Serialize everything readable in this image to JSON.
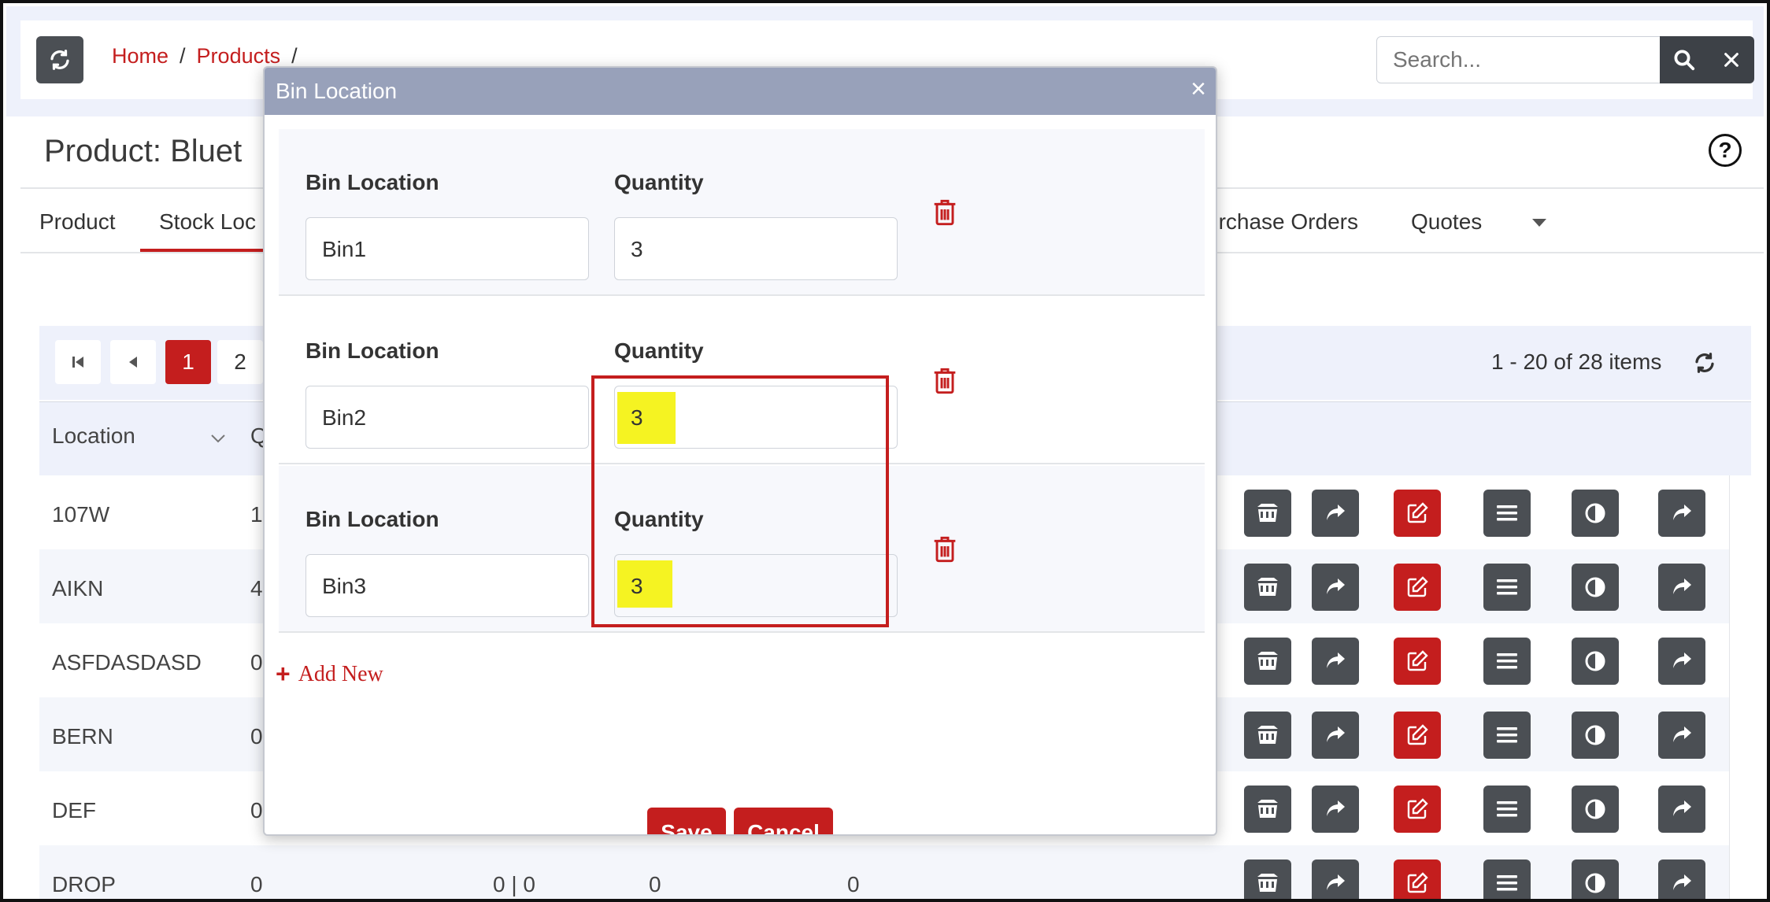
{
  "header": {
    "breadcrumb": [
      {
        "label": "Home",
        "sep": "/"
      },
      {
        "label": "Products",
        "sep": "/"
      }
    ],
    "search_placeholder": "Search..."
  },
  "page": {
    "title": "Product: Bluet",
    "tabs": [
      "Product",
      "Stock Loc",
      "urchase Orders",
      "Quotes"
    ]
  },
  "grid": {
    "pages": [
      "1",
      "2"
    ],
    "items_count": "1 - 20 of 28 items",
    "columns": [
      "Location",
      "Q"
    ],
    "rows": [
      {
        "location": "107W",
        "q": "1"
      },
      {
        "location": "AIKN",
        "q": "4"
      },
      {
        "location": "ASFDASDASD",
        "q": "0"
      },
      {
        "location": "BERN",
        "q": "0"
      },
      {
        "location": "DEF",
        "q": "0"
      },
      {
        "location": "DROP",
        "q": "0",
        "c3": "0 | 0",
        "c4": "0",
        "c5": "0"
      }
    ],
    "row_actions": [
      "dumpster-icon",
      "share-icon",
      "edit-icon",
      "menu-icon",
      "contrast-icon",
      "forward-icon"
    ]
  },
  "modal": {
    "title": "Bin Location",
    "close": "×",
    "bin_label": "Bin Location",
    "qty_label": "Quantity",
    "rows": [
      {
        "bin": "Bin1",
        "qty": "3"
      },
      {
        "bin": "Bin2",
        "qty": "3"
      },
      {
        "bin": "Bin3",
        "qty": "3"
      }
    ],
    "add_new": "Add New",
    "save": "Save",
    "cancel": "Cancel"
  },
  "colors": {
    "accent": "#c41e1e",
    "dark_button": "#4b4f54",
    "modal_header": "#98a1ba",
    "highlight": "#f5f322"
  }
}
